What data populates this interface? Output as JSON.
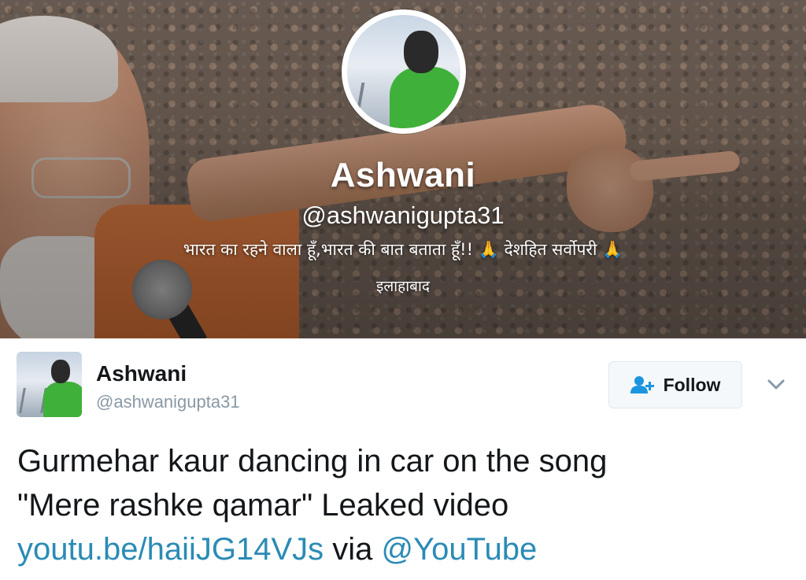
{
  "profile": {
    "name": "Ashwani",
    "handle": "@ashwanigupta31",
    "bio": "भारत का रहने वाला हूँ,भारत की बात बताता हूँ!! 🙏 देशहित सर्वोपरी 🙏",
    "location": "इलाहाबाद"
  },
  "tweet": {
    "author_name": "Ashwani",
    "author_handle": "@ashwanigupta31",
    "follow_label": "Follow",
    "text_line1": "Gurmehar kaur dancing in car on the song",
    "text_line2": "\"Mere rashke qamar\" Leaked video",
    "link": "youtu.be/haiiJG14VJs",
    "via": " via ",
    "mention": "@YouTube"
  },
  "icons": {
    "follow": "add-user-icon",
    "menu": "chevron-down-icon"
  },
  "colors": {
    "link": "#2b8bb5",
    "text": "#14171a",
    "muted": "#8899a6",
    "follow_icon": "#1b95e0"
  }
}
